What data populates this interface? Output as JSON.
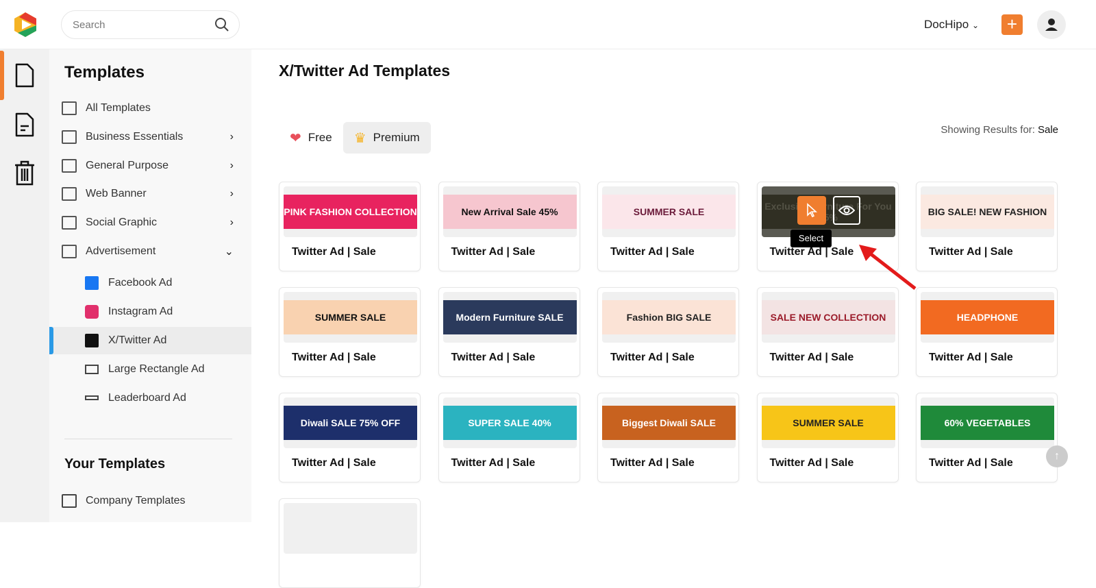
{
  "header": {
    "search_placeholder": "Search",
    "brand": "DocHipo",
    "add_label": "+"
  },
  "sidebar": {
    "title": "Templates",
    "items": [
      {
        "label": "All Templates",
        "icon": "layout-icon",
        "chevron": ""
      },
      {
        "label": "Business Essentials",
        "icon": "building-icon",
        "chevron": "›"
      },
      {
        "label": "General Purpose",
        "icon": "checklist-icon",
        "chevron": "›"
      },
      {
        "label": "Web Banner",
        "icon": "banner-icon",
        "chevron": "›"
      },
      {
        "label": "Social Graphic",
        "icon": "social-icon",
        "chevron": "›"
      },
      {
        "label": "Advertisement",
        "icon": "ad-icon",
        "chevron": "⌄"
      }
    ],
    "sub_items": [
      {
        "label": "Facebook Ad",
        "icon": "facebook-icon"
      },
      {
        "label": "Instagram Ad",
        "icon": "instagram-icon"
      },
      {
        "label": "X/Twitter Ad",
        "icon": "x-icon",
        "active": true
      },
      {
        "label": "Large Rectangle Ad",
        "icon": "rectangle-icon"
      },
      {
        "label": "Leaderboard Ad",
        "icon": "leaderboard-icon"
      }
    ],
    "your_templates_title": "Your Templates",
    "company_templates": "Company Templates"
  },
  "main": {
    "title": "X/Twitter Ad Templates",
    "tabs": [
      {
        "label": "Free",
        "icon": "heart-icon"
      },
      {
        "label": "Premium",
        "icon": "crown-icon",
        "active": true
      }
    ],
    "results_label": "Showing Results for:",
    "results_query": "Sale",
    "tooltip": "Select",
    "cards": [
      {
        "title": "Twitter Ad | Sale",
        "headline": "PINK FASHION COLLECTION",
        "bg": "#e8235f",
        "fg": "#ffffff"
      },
      {
        "title": "Twitter Ad | Sale",
        "headline": "New Arrival  Sale 45%",
        "bg": "#f6c6cf",
        "fg": "#111111"
      },
      {
        "title": "Twitter Ad | Sale",
        "headline": "SUMMER SALE",
        "bg": "#fbe6ea",
        "fg": "#6b1b3a"
      },
      {
        "title": "Twitter Ad | Sale",
        "headline": "Exclusive Furniture For You  55%",
        "bg": "#4a4437",
        "fg": "#cfc9b8",
        "hover": true
      },
      {
        "title": "Twitter Ad | Sale",
        "headline": "BIG SALE! NEW FASHION",
        "bg": "#fbe9e1",
        "fg": "#222222"
      },
      {
        "title": "Twitter Ad | Sale",
        "headline": "SUMMER SALE",
        "bg": "#f9d2b0",
        "fg": "#111111"
      },
      {
        "title": "Twitter Ad | Sale",
        "headline": "Modern Furniture  SALE",
        "bg": "#2b3a5c",
        "fg": "#ffffff"
      },
      {
        "title": "Twitter Ad | Sale",
        "headline": "Fashion BIG SALE",
        "bg": "#fbe3d6",
        "fg": "#222222"
      },
      {
        "title": "Twitter Ad | Sale",
        "headline": "SALE NEW COLLECTION",
        "bg": "#f3e3e3",
        "fg": "#9b1b2a"
      },
      {
        "title": "Twitter Ad | Sale",
        "headline": "HEADPHONE",
        "bg": "#f26a21",
        "fg": "#ffffff"
      },
      {
        "title": "Twitter Ad | Sale",
        "headline": "Diwali SALE  75% OFF",
        "bg": "#1d2f6b",
        "fg": "#ffffff"
      },
      {
        "title": "Twitter Ad | Sale",
        "headline": "SUPER SALE  40%",
        "bg": "#2bb3c0",
        "fg": "#ffffff"
      },
      {
        "title": "Twitter Ad | Sale",
        "headline": "Biggest Diwali SALE",
        "bg": "#c8621f",
        "fg": "#ffffff"
      },
      {
        "title": "Twitter Ad | Sale",
        "headline": "SUMMER SALE",
        "bg": "#f7c518",
        "fg": "#222222"
      },
      {
        "title": "Twitter Ad | Sale",
        "headline": "60% VEGETABLES",
        "bg": "#1f8a3a",
        "fg": "#ffffff"
      },
      {
        "title": "",
        "headline": "",
        "bg": "#f0f0f0",
        "fg": "#000000"
      }
    ]
  },
  "colors": {
    "accent": "#f07e2f",
    "active_indicator": "#2a9ae6"
  }
}
